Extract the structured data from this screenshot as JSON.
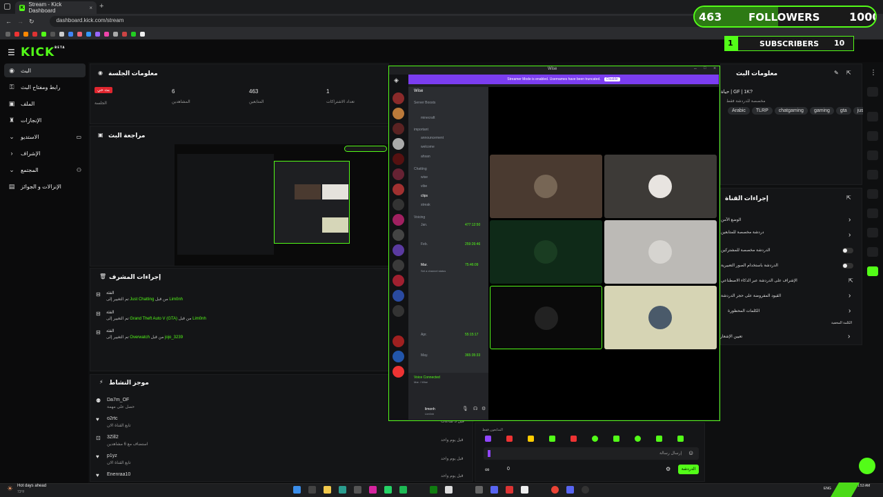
{
  "browser": {
    "tab_title": "Stream - Kick Dashboard",
    "tab_favicon": "K",
    "new_tab": "+",
    "url": "dashboard.kick.com/stream"
  },
  "overlay": {
    "followers_count": "463",
    "followers_label": "FOLLOWERS",
    "followers_goal": "1000",
    "followers_progress": 0.463,
    "subscribers_count": "1",
    "subscribers_label": "SUBSCRIBERS",
    "subscribers_goal": "10",
    "subscribers_progress": 0.1
  },
  "kick": {
    "logo": "KICK",
    "logo_badge": "BETA",
    "accent": "#53fc18"
  },
  "sidebar": {
    "items": [
      {
        "label": "البث",
        "icon": "stream-icon"
      },
      {
        "label": "رابط ومفتاح البث",
        "icon": "key-icon"
      },
      {
        "label": "الملف",
        "icon": "profile-icon"
      },
      {
        "label": "الإنجازات",
        "icon": "trophy-icon"
      },
      {
        "label": "الاستديو",
        "icon": "chevron-down-icon"
      },
      {
        "label": "الإشراف",
        "icon": "shield-icon"
      },
      {
        "label": "المجتمع",
        "icon": "chevron-down-icon"
      },
      {
        "label": "الإنزالات و الجوائز",
        "icon": "gift-icon"
      }
    ]
  },
  "session": {
    "title": "معلومات الجلسة",
    "live_badge": "بث حي",
    "live_caption": "الجلسة",
    "stats": [
      {
        "value": "6",
        "label": "المشاهدين"
      },
      {
        "value": "463",
        "label": "المتابعين"
      },
      {
        "value": "1",
        "label": "تعداد الاشتراكات"
      }
    ]
  },
  "preview": {
    "title": "مراجعة البث"
  },
  "modactions": {
    "title": "إجراءات المشرف",
    "rows": [
      {
        "head": "الفئة",
        "pre": "تم التغيير إلى",
        "game": "Just Chatting",
        "by": "من قبل",
        "user": "Lim0nh"
      },
      {
        "head": "الفئة",
        "pre": "تم التغيير إلى",
        "game": "Grand Theft Auto V (GTA)",
        "by": "من قبل",
        "user": "Lim0nh"
      },
      {
        "head": "الفئة",
        "pre": "تم التغيير إلى",
        "game": "Overwatch",
        "by": "من قبل",
        "user": "jojo_3239"
      }
    ]
  },
  "activity": {
    "title": "موجز النشاط",
    "rows": [
      {
        "user": "Da7m_OF",
        "sub": "حصل على مهمة",
        "time": "",
        "icon": "bolt-icon"
      },
      {
        "user": "o2rtc",
        "sub": "تابع القناة الان",
        "time": "قبل 3 ساعات",
        "icon": "heart-icon"
      },
      {
        "user": "3Zill2",
        "sub": "استضاف مع 6 مشاهدين",
        "time": "قبل يوم واحد",
        "icon": "host-icon"
      },
      {
        "user": "p1yz",
        "sub": "تابع القناة الان",
        "time": "قبل يوم واحد",
        "icon": "heart-icon"
      },
      {
        "user": "Enenraa10",
        "sub": "",
        "time": "قبل يوم واحد",
        "icon": "heart-icon"
      }
    ]
  },
  "streaminfo": {
    "title": "معلومات البث",
    "stream_title": "حياة | GF | 1K?",
    "category": "مخصصة للدردشة فقط",
    "tags": [
      "Arabic",
      "TLRP",
      "chatgaming",
      "gaming",
      "gta",
      "jus"
    ]
  },
  "channelactions": {
    "title": "إجراءات القناة",
    "items": [
      "الوضع الآمن",
      "دردشة مخصصة للمتابعين",
      "الدردشة مخصصة للمشتركين",
      "الدردشة باستخدام الصور التعبيرية",
      "الإشراف على الدردشة عبر الذكاء الاصطناعي",
      "القيود المفروضة على حجر الدردشة",
      "الكلمات المحظورة",
      "الكلمة المخفية",
      "تعيين الإشعار"
    ]
  },
  "chat": {
    "pinned_label": "المتابعون فقط",
    "placeholder": "إرسال رسالة",
    "send_label": "الدردشة",
    "count": "0"
  },
  "discord": {
    "window_title": "Wise",
    "banner": "Streamer Mode is enabled. Usernames have been truncated.",
    "banner_button": "Disable",
    "server_name": "Wise",
    "server_boosts": "Server Boosts",
    "channels": [
      {
        "kind": "text",
        "name": "minecraft"
      },
      {
        "kind": "cat",
        "name": "important"
      },
      {
        "kind": "text",
        "name": "announcement"
      },
      {
        "kind": "text",
        "name": "welcome"
      },
      {
        "kind": "text",
        "name": "ahsan"
      },
      {
        "kind": "cat",
        "name": "Chatting"
      },
      {
        "kind": "text",
        "name": "wise"
      },
      {
        "kind": "text",
        "name": "vibe"
      },
      {
        "kind": "text",
        "name": "clips"
      },
      {
        "kind": "text",
        "name": "streak"
      },
      {
        "kind": "cat",
        "name": "Voicing"
      }
    ],
    "voice": [
      {
        "name": "Jan.",
        "time": "477:12:50",
        "user": "Jan."
      },
      {
        "name": "Feb.",
        "time": "259:26:46",
        "user": "Feb."
      },
      {
        "name": "Mar.",
        "time": "75:46:09",
        "user": "Set a channel status"
      },
      {
        "name": "Apr.",
        "time": "55:15:17",
        "user": "Apr."
      },
      {
        "name": "May.",
        "time": "365:35:33",
        "user": "May."
      }
    ],
    "voice_connected": "Voice Connected",
    "voice_sub": "Mar. / Wise",
    "me_name": "limonh",
    "me_tag": "Lim0nh"
  },
  "taskbar": {
    "weather": "Hot days ahead",
    "temp": "73°F",
    "lang": "ENG",
    "clock": "1:53 AM"
  }
}
